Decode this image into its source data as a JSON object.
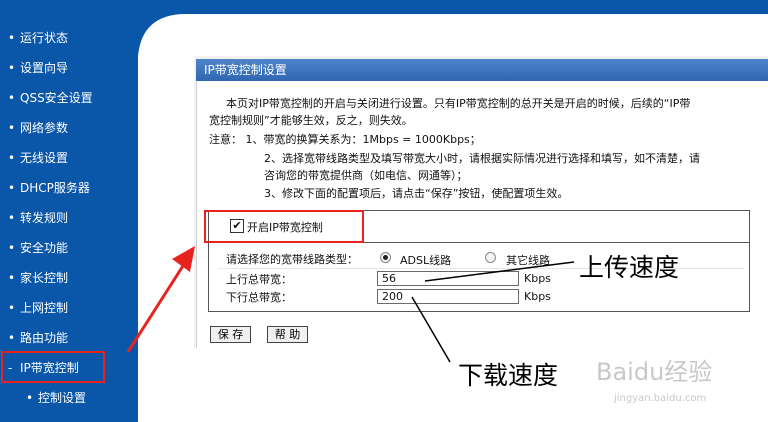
{
  "sidebar": {
    "items": [
      {
        "label": "运行状态"
      },
      {
        "label": "设置向导"
      },
      {
        "label": "QSS安全设置"
      },
      {
        "label": "网络参数"
      },
      {
        "label": "无线设置"
      },
      {
        "label": "DHCP服务器"
      },
      {
        "label": "转发规则"
      },
      {
        "label": "安全功能"
      },
      {
        "label": "家长控制"
      },
      {
        "label": "上网控制"
      },
      {
        "label": "路由功能"
      },
      {
        "label": "IP带宽控制"
      },
      {
        "label": "控制设置"
      }
    ],
    "bullet": "•",
    "active_bullet": "-"
  },
  "panel": {
    "title": "IP带宽控制设置",
    "intro_line1": "本页对IP带宽控制的开启与关闭进行设置。只有IP带宽控制的总开关是开启的时候，后续的“IP带",
    "intro_line2": "宽控制规则”才能够生效，反之，则失效。",
    "note_line1": "注意：  1、带宽的换算关系为：1Mbps = 1000Kbps；",
    "note_line2": "2、选择宽带线路类型及填写带宽大小时，请根据实际情况进行选择和填写，如不清楚，请",
    "note_line3": "咨询您的带宽提供商（如电信、网通等）；",
    "note_line4": "3、修改下面的配置项后，请点击“保存”按钮，使配置项生效。",
    "enable_label": "开启IP带宽控制",
    "enable_checked_glyph": "✔",
    "line_type_label": "请选择您的宽带线路类型：",
    "option_adsl": "ADSL线路",
    "option_other": "其它线路",
    "up_label": "上行总带宽：",
    "up_value": "56",
    "up_unit": "Kbps",
    "down_label": "下行总带宽：",
    "down_value": "200",
    "down_unit": "Kbps",
    "save_button": "保 存",
    "help_button": "帮 助"
  },
  "annotations": {
    "upload": "上传速度",
    "download": "下载速度",
    "color": "#e8231e"
  },
  "watermark": {
    "text": "Baidu经验",
    "sub": "jingyan.baidu.com"
  }
}
